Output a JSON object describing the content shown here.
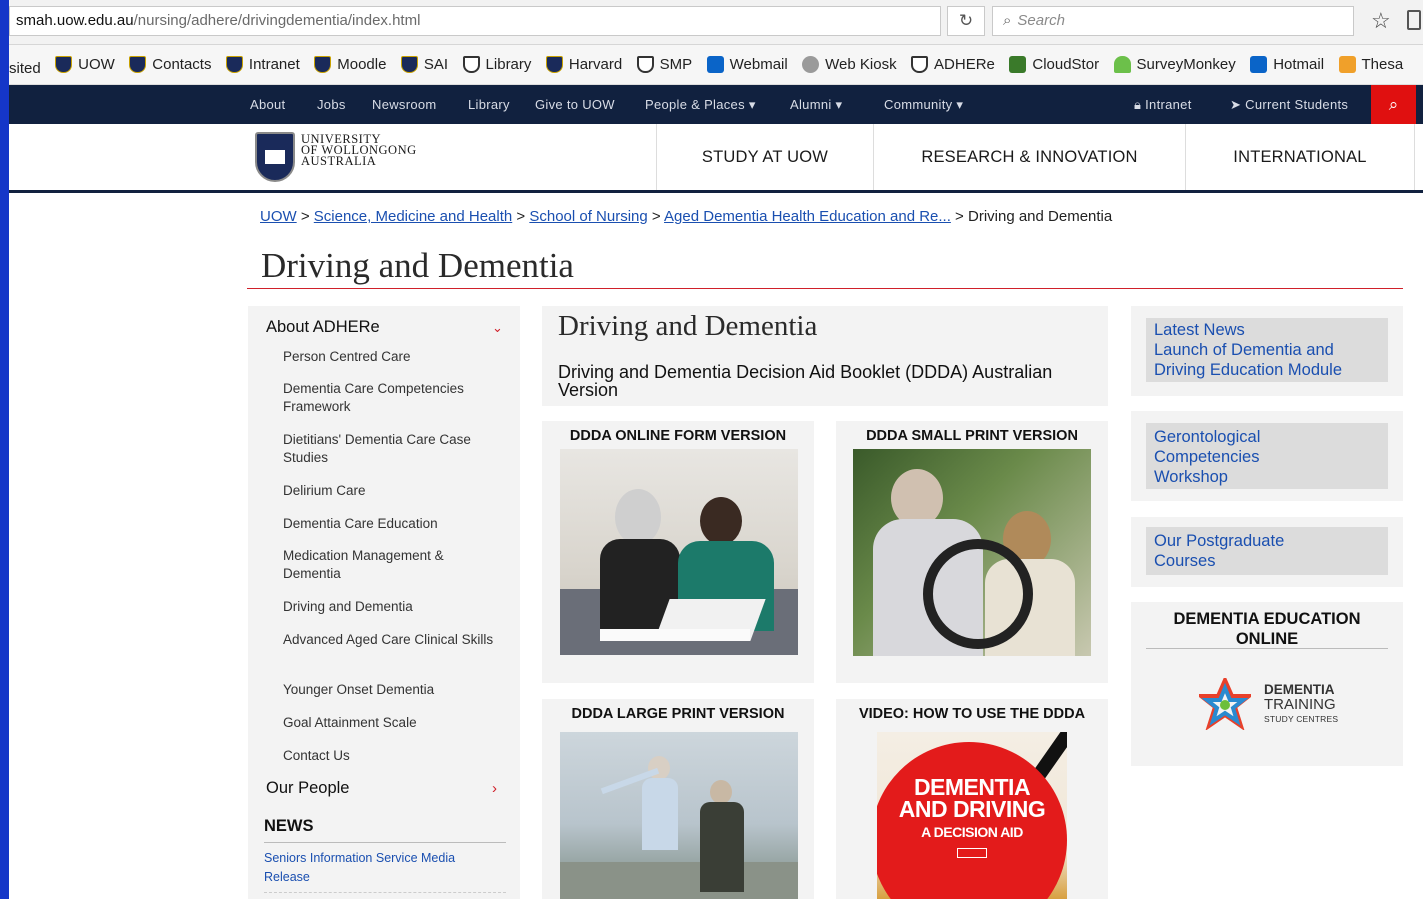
{
  "browser": {
    "url_host": "smah.uow.edu.au",
    "url_path": "/nursing/adhere/drivingdementia/index.html",
    "search_placeholder": "Search",
    "bookmarks": [
      "sited",
      "UOW",
      "Contacts",
      "Intranet",
      "Moodle",
      "SAI",
      "Library",
      "Harvard",
      "SMP",
      "Webmail",
      "Web Kiosk",
      "ADHERe",
      "CloudStor",
      "SurveyMonkey",
      "Hotmail",
      "Thesa"
    ]
  },
  "topnav": {
    "items": [
      "About",
      "Jobs",
      "Newsroom",
      "Library",
      "Give to UOW",
      "People & Places",
      "Alumni",
      "Community"
    ],
    "intranet": "Intranet",
    "students": "Current Students"
  },
  "header": {
    "logo_line1": "UNIVERSITY",
    "logo_line2": "OF WOLLONGONG",
    "logo_line3": "AUSTRALIA",
    "nav": [
      "STUDY AT UOW",
      "RESEARCH & INNOVATION",
      "INTERNATIONAL"
    ]
  },
  "breadcrumb": [
    "UOW",
    "Science, Medicine and Health",
    "School of Nursing",
    "Aged Dementia Health Education and Re...",
    "Driving and Dementia"
  ],
  "page_title": "Driving and Dementia",
  "sidebar": {
    "section1": "About ADHERe",
    "items": [
      "Person Centred Care",
      "Dementia Care Competencies Framework",
      "Dietitians' Dementia Care Case Studies",
      "Delirium Care",
      "Dementia Care Education",
      "Medication Management & Dementia",
      "Driving and Dementia",
      "Advanced Aged Care Clinical Skills",
      "Younger Onset Dementia",
      "Goal Attainment Scale",
      "Contact Us"
    ],
    "section2": "Our People",
    "news_heading": "NEWS",
    "news_link": "Seniors Information Service Media Release"
  },
  "main": {
    "title": "Driving and Dementia",
    "subtitle": "Driving and Dementia Decision Aid Booklet (DDDA) Australian Version",
    "tiles": [
      "DDDA ONLINE FORM VERSION",
      "DDDA SMALL PRINT VERSION",
      "DDDA LARGE PRINT VERSION",
      "VIDEO: HOW TO USE THE DDDA"
    ],
    "video_line1": "DEMENTIA",
    "video_line2": "AND DRIVING",
    "video_line3": "A DECISION AID"
  },
  "right": {
    "news_label": "Latest News",
    "news_text": "Launch of Dementia and Driving Education Module",
    "gero": "Gerontological Competencies Workshop",
    "postgrad": "Our Postgraduate Courses",
    "deo_title": "DEMENTIA EDUCATION ONLINE",
    "dtsc_line1": "DEMENTIA",
    "dtsc_line2": "TRAINING",
    "dtsc_line3": "STUDY CENTRES"
  },
  "colors": {
    "navy": "#11213f",
    "accent_red": "#d0202a",
    "link_blue": "#1a4fb0"
  }
}
